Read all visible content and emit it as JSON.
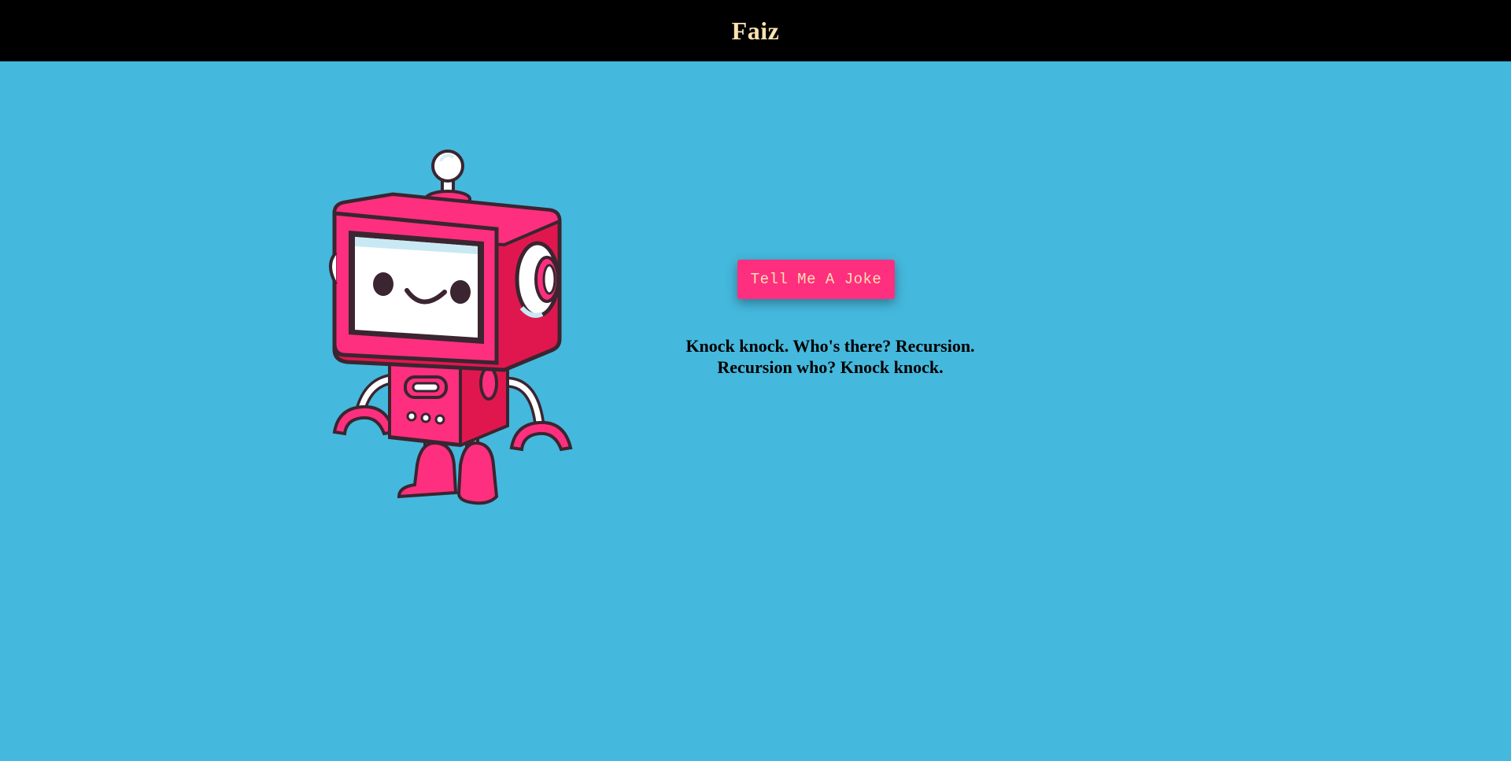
{
  "header": {
    "title": "Faiz"
  },
  "main": {
    "button_label": "Tell Me A Joke",
    "joke": "Knock knock. Who's there? Recursion. Recursion who? Knock knock."
  },
  "colors": {
    "background": "#45b8dd",
    "header_bg": "#000000",
    "header_text": "#fde3b0",
    "button_bg": "#ff2f7f",
    "button_text": "#fde3b0",
    "robot_body": "#ff2f7f"
  },
  "icons": {
    "robot_illustration": "robot-icon"
  }
}
